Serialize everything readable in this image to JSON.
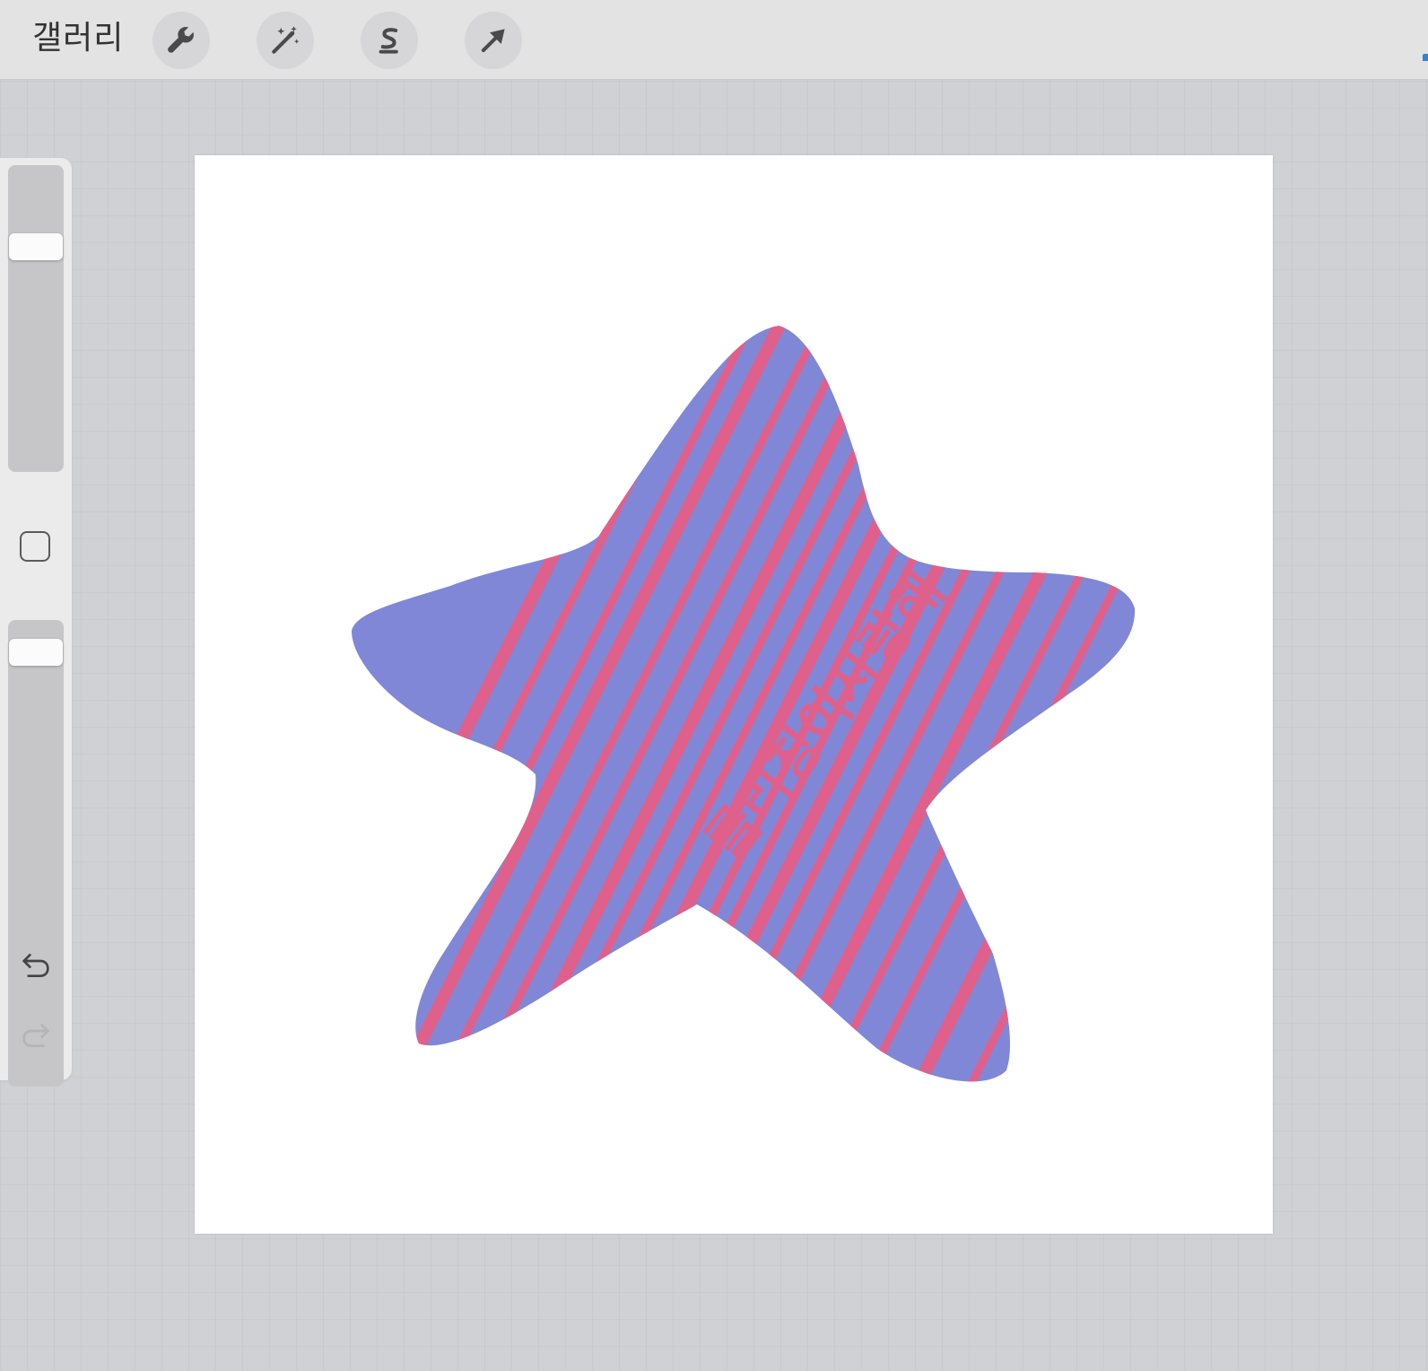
{
  "topbar": {
    "gallery_label": "갤러리",
    "tools": [
      {
        "name": "actions",
        "icon": "wrench-icon"
      },
      {
        "name": "adjustments",
        "icon": "magic-wand-icon"
      },
      {
        "name": "selection",
        "icon": "selection-s-icon"
      },
      {
        "name": "transform",
        "icon": "arrow-cursor-icon"
      }
    ]
  },
  "sidebar": {
    "brush_size": 0.76,
    "opacity": 0.96,
    "modify_icon": "square-icon",
    "undo_icon": "undo-icon",
    "redo_icon": "redo-icon"
  },
  "artwork": {
    "star_color": "#8087d6",
    "stripe_color": "#e0608c",
    "background_color": "#ffffff",
    "handwritten_text": "콜리칭이사랑해"
  }
}
